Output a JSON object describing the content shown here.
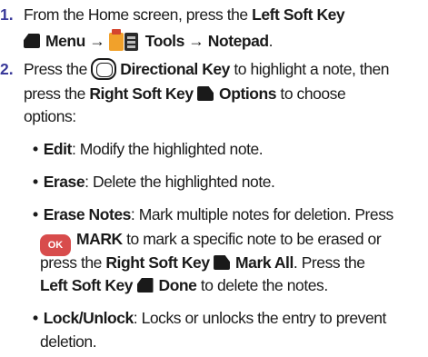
{
  "steps": [
    {
      "number": "1.",
      "l1": {
        "pre": "From the Home screen, press the ",
        "bold": "Left Soft Key"
      },
      "l2": {
        "menu": "Menu",
        "arrow1": " → ",
        "tools": "Tools",
        "arrow2": " → ",
        "notepad": "Notepad",
        "end": "."
      }
    },
    {
      "number": "2.",
      "l1": {
        "pre": "Press the ",
        "bold": "Directional Key",
        "post": " to highlight a note, then"
      },
      "l2": {
        "pre": "press the ",
        "bold": "Right Soft Key",
        "bold2": "Options",
        "post": " to choose"
      },
      "l3": "options:"
    }
  ],
  "bullets": {
    "edit": {
      "label": "Edit",
      "text": ": Modify the highlighted note."
    },
    "erase": {
      "label": "Erase",
      "text": ": Delete the highlighted note."
    },
    "erase_notes": {
      "label": "Erase Notes",
      "l1": ": Mark multiple notes for deletion. Press",
      "ok": "OK",
      "mark": "MARK",
      "l2": " to mark a specific note to be erased or",
      "l3_pre": "press the ",
      "l3_bold": "Right Soft Key",
      "l3_bold2": "Mark All",
      "l3_post": ". Press the",
      "l4_bold": "Left Soft Key",
      "l4_bold2": "Done",
      "l4_post": " to delete the notes."
    },
    "lock": {
      "label": "Lock/Unlock",
      "l1": ": Locks or unlocks the entry to prevent",
      "l2": "deletion."
    }
  }
}
